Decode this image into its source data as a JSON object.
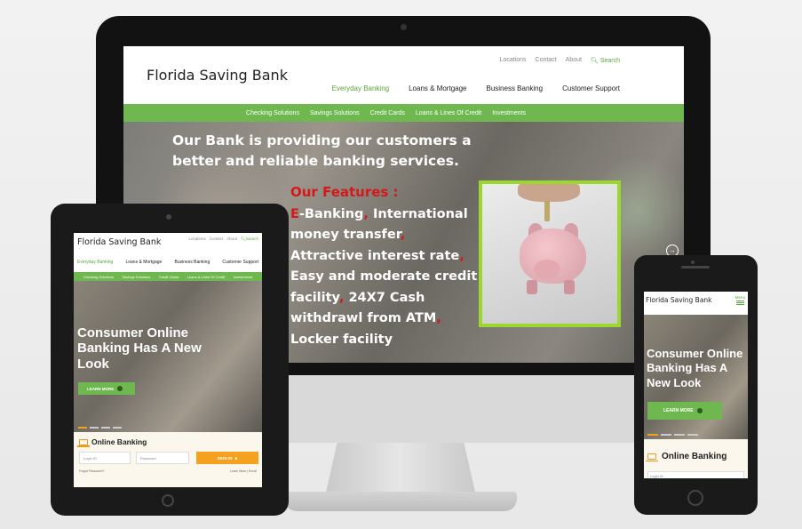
{
  "desktop": {
    "logo": "Florida Saving Bank",
    "top_links": [
      "Locations",
      "Contact",
      "About"
    ],
    "search_label": "Search",
    "main_nav": [
      "Everyday Banking",
      "Loans & Mortgage",
      "Business Banking",
      "Customer Support"
    ],
    "sub_nav": [
      "Checking Solutions",
      "Savings Solutions",
      "Credit Cards",
      "Loans & Lines Of Credit",
      "Investments"
    ],
    "hero_headline": "Our Bank is providing our customers a better and reliable banking services.",
    "features_title": "Our Features :",
    "features_first_letter": "E",
    "features_items": [
      "-Banking",
      "International money transfer",
      "Attractive interest rate",
      "Easy and moderate credit facility",
      "24X7 Cash withdrawl from ATM",
      "Locker facility"
    ],
    "separator": ","
  },
  "tablet": {
    "logo": "Florida Saving Bank",
    "top_links": [
      "Locations",
      "Contact",
      "About"
    ],
    "search_label": "Search",
    "main_nav": [
      "Everyday Banking",
      "Loans & Mortgage",
      "Business Banking",
      "Customer Support"
    ],
    "sub_nav": [
      "Checking Solutions",
      "Savings Solutions",
      "Credit Cards",
      "Loans & Lines Of Credit",
      "Investments"
    ],
    "hero_headline": "Consumer Online Banking Has A New Look",
    "learn_more": "LEARN MORE",
    "online_banking_title": "Online Banking",
    "login_placeholder": "Login ID",
    "password_placeholder": "Password",
    "sign_in": "SIGN IN",
    "forgot_password": "Forgot Password?",
    "learn_more_enroll": "Learn More | Enroll"
  },
  "phone": {
    "logo": "Florida Saving Bank",
    "menu_label": "Menu",
    "hero_headline": "Consumer Online Banking Has A New Look",
    "learn_more": "LEARN MORE",
    "online_banking_title": "Online Banking",
    "login_placeholder": "Login ID"
  },
  "colors": {
    "accent_green": "#6fb84f",
    "orange": "#f5a11f",
    "feature_red": "#d4191b",
    "frame_lime": "#9ad82e"
  }
}
